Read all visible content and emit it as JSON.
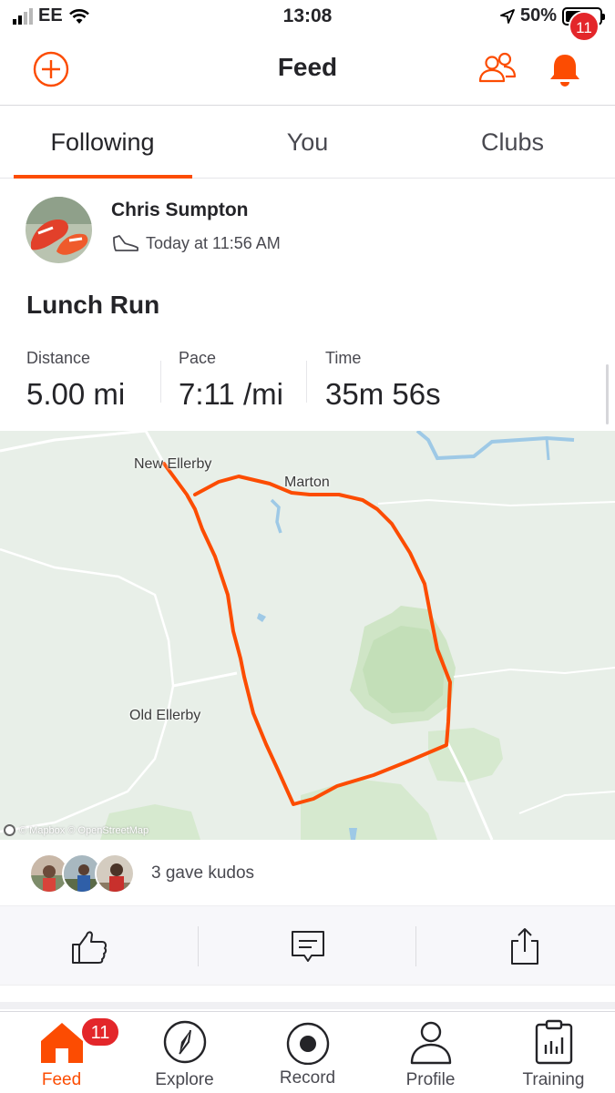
{
  "status_bar": {
    "carrier": "EE",
    "time": "13:08",
    "battery": "50%",
    "battery_level": 0.5
  },
  "header": {
    "title": "Feed",
    "notification_count": "11"
  },
  "tabs": [
    {
      "label": "Following",
      "active": true
    },
    {
      "label": "You",
      "active": false
    },
    {
      "label": "Clubs",
      "active": false
    }
  ],
  "activity": {
    "athlete_name": "Chris Sumpton",
    "timestamp": "Today at 11:56 AM",
    "title": "Lunch Run",
    "stats": [
      {
        "label": "Distance",
        "value": "5.00 mi"
      },
      {
        "label": "Pace",
        "value": "7:11 /mi"
      },
      {
        "label": "Time",
        "value": "35m 56s"
      }
    ],
    "map": {
      "places": [
        "New Ellerby",
        "Marton",
        "Old Ellerby"
      ],
      "attribution": "© Mapbox © OpenStreetMap",
      "route_color": "#fc4c02"
    },
    "kudos_text": "3 gave kudos"
  },
  "bottom_nav": {
    "items": [
      {
        "label": "Feed",
        "icon": "home-icon",
        "active": true
      },
      {
        "label": "Explore",
        "icon": "compass-icon",
        "active": false
      },
      {
        "label": "Record",
        "icon": "record-icon",
        "active": false
      },
      {
        "label": "Profile",
        "icon": "person-icon",
        "active": false
      },
      {
        "label": "Training",
        "icon": "clipboard-chart-icon",
        "active": false
      }
    ],
    "feed_badge": "11"
  },
  "colors": {
    "accent": "#fc4c02",
    "badge": "#e3262a"
  }
}
